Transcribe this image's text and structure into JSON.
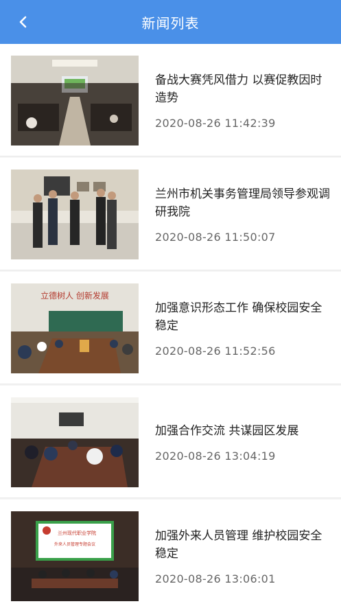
{
  "header": {
    "title": "新闻列表",
    "back_icon": "chevron-left-icon",
    "background": "#4a90e8"
  },
  "news": [
    {
      "title": "备战大赛凭风借力 以赛促教因时造势",
      "time": "2020-08-26 11:42:39"
    },
    {
      "title": "兰州市机关事务管理局领导参观调研我院",
      "time": "2020-08-26 11:50:07"
    },
    {
      "title": "加强意识形态工作 确保校园安全稳定",
      "time": "2020-08-26 11:52:56"
    },
    {
      "title": "加强合作交流 共谋园区发展",
      "time": "2020-08-26 13:04:19"
    },
    {
      "title": "加强外来人员管理 维护校园安全稳定",
      "time": "2020-08-26 13:06:01"
    }
  ],
  "thumb5": {
    "line1": "兰州现代职业学院",
    "line2": "外来人员管理专题会议"
  },
  "thumb3": {
    "banner": "立德树人 创新发展"
  }
}
